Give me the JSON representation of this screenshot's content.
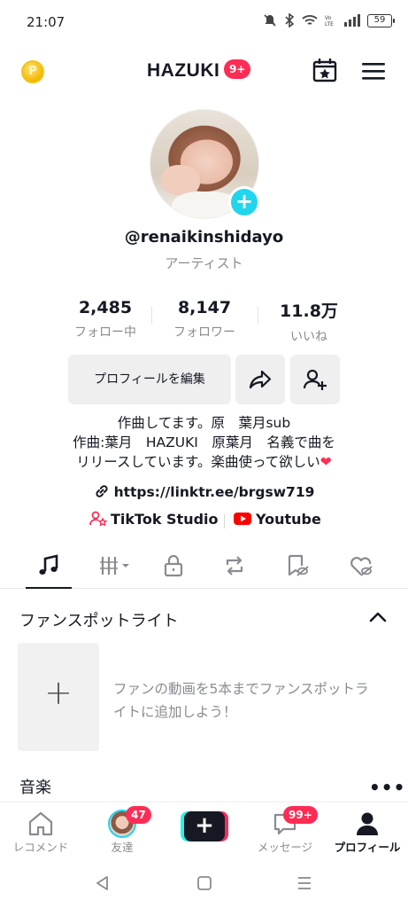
{
  "status_bar": {
    "time": "21:07",
    "battery": "59"
  },
  "header": {
    "title": "HAZUKI",
    "badge": "9+",
    "coin_glyph": "P"
  },
  "profile": {
    "username": "@renaikinshidayo",
    "category": "アーティスト",
    "stats": [
      {
        "value": "2,485",
        "label": "フォロー中"
      },
      {
        "value": "8,147",
        "label": "フォロワー"
      },
      {
        "value": "11.8万",
        "label": "いいね"
      }
    ],
    "edit_button": "プロフィールを編集",
    "bio": {
      "line1": "作曲してます。原　葉月sub",
      "line2": "作曲:葉月　HAZUKI　原葉月　名義で曲を",
      "line3": "リリースしています。楽曲使って欲しい",
      "heart": "❤"
    },
    "link": "https://linktr.ee/brgsw719",
    "studio_label": "TikTok Studio",
    "youtube_label": "Youtube"
  },
  "fan_spotlight": {
    "title": "ファンスポットライト",
    "add_glyph": "+",
    "description": "ファンの動画を5本までファンスポットライトに追加しよう！"
  },
  "music_section": {
    "title": "音楽",
    "more": "•••"
  },
  "bottom_nav": {
    "items": [
      {
        "label": "レコメンド"
      },
      {
        "label": "友達",
        "badge": "47"
      },
      {
        "label": ""
      },
      {
        "label": "メッセージ",
        "badge": "99+"
      },
      {
        "label": "プロフィール"
      }
    ],
    "create_glyph": "+"
  },
  "colors": {
    "accent": "#fe2c55",
    "cyan": "#20d5ec",
    "text": "#161823",
    "muted": "#8a8b91"
  }
}
